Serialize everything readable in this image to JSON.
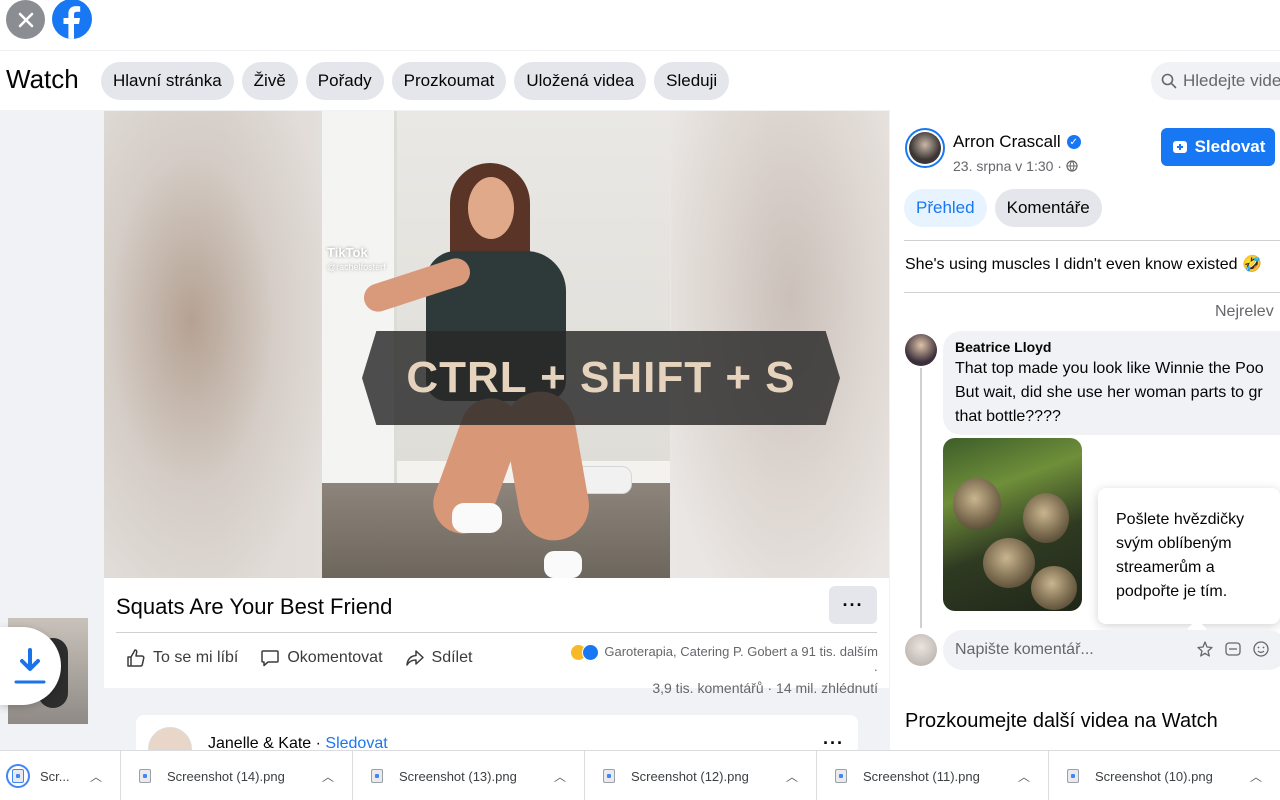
{
  "watch": {
    "title": "Watch",
    "tabs": [
      "Hlavní stránka",
      "Živě",
      "Pořady",
      "Prozkoumat",
      "Uložená videa",
      "Sleduji"
    ],
    "search_placeholder": "Hledejte vide"
  },
  "video": {
    "overlay_shortcut": "CTRL + SHIFT + S",
    "tiktok_label": "TikTok",
    "tiktok_handle": "@rachelfosterf",
    "title": "Squats Are Your Best Friend",
    "more_label": "···",
    "actions": {
      "like": "To se mi líbí",
      "comment": "Okomentovat",
      "share": "Sdílet"
    },
    "reactions_text": "Garoterapia, Catering P. Gobert a 91 tis. dalším ·",
    "stats_text": "3,9 tis. komentářů · 14 mil. zhlédnutí"
  },
  "next_card": {
    "name": "Janelle & Kate",
    "separator": " · ",
    "follow": "Sledovat",
    "more_label": "···"
  },
  "author": {
    "name": "Arron Crascall",
    "date": "23. srpna v 1:30 ·",
    "follow_button": "Sledovat"
  },
  "right_tabs": {
    "overview": "Přehled",
    "comments": "Komentáře"
  },
  "caption": "She's using muscles I didn't even know existed 🤣",
  "sort_label": "Nejrelev",
  "comment": {
    "author": "Beatrice Lloyd",
    "lines": [
      "That top made you look like Winnie the Poo",
      "But wait, did she use her woman parts to gr",
      "that bottle????"
    ]
  },
  "tooltip_lines": [
    "Pošlete hvězdičky",
    "svým oblíbeným",
    "streamerům a",
    "podpořte je tím."
  ],
  "comment_input_placeholder": "Napište komentář...",
  "explore_heading": "Prozkoumejte další videa na Watch",
  "downloads": [
    "Scr...",
    "Screenshot (14).png",
    "Screenshot (13).png",
    "Screenshot (12).png",
    "Screenshot (11).png",
    "Screenshot (10).png"
  ],
  "colors": {
    "brand": "#1877f2",
    "chip": "#e4e6eb",
    "page_bg": "#f0f2f5"
  },
  "icons": [
    "close-icon",
    "facebook-logo-icon",
    "search-icon",
    "like-icon",
    "comment-icon",
    "share-icon",
    "verified-icon",
    "globe-icon",
    "download-icon",
    "file-icon",
    "chevron-up-icon",
    "sticker-icon",
    "gif-icon",
    "emoji-icon"
  ]
}
